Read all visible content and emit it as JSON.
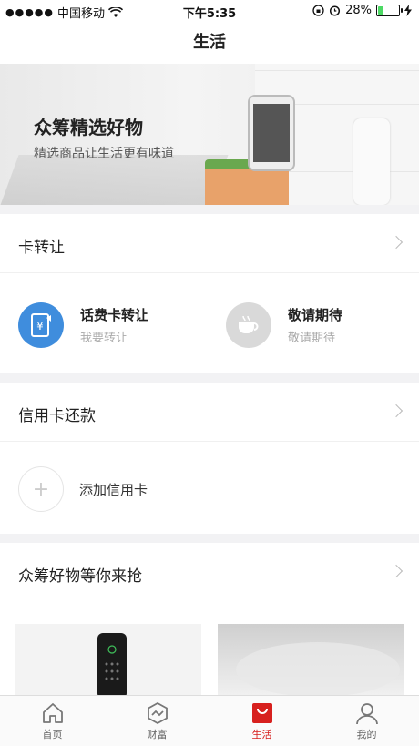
{
  "status": {
    "carrier": "中国移动",
    "time": "下午5:35",
    "battery": "28%",
    "battery_level": 0.28
  },
  "nav": {
    "title": "生活"
  },
  "banner": {
    "title": "众筹精选好物",
    "subtitle": "精选商品让生活更有味道"
  },
  "card_transfer": {
    "title": "卡转让",
    "items": [
      {
        "title": "话费卡转让",
        "subtitle": "我要转让",
        "icon": "mobile-card-icon"
      },
      {
        "title": "敬请期待",
        "subtitle": "敬请期待",
        "icon": "coffee-cup-icon"
      }
    ]
  },
  "credit_card": {
    "title": "信用卡还款",
    "add_label": "添加信用卡",
    "add_symbol": "+"
  },
  "crowdfunding": {
    "title": "众筹好物等你来抢"
  },
  "tabs": [
    {
      "label": "首页",
      "icon": "home-icon"
    },
    {
      "label": "财富",
      "icon": "wealth-icon"
    },
    {
      "label": "生活",
      "icon": "life-bag-icon",
      "active": true
    },
    {
      "label": "我的",
      "icon": "profile-icon"
    }
  ],
  "colors": {
    "accent": "#d7201e",
    "blue": "#3f8ddd",
    "gray_icon": "#d9d9d9"
  }
}
